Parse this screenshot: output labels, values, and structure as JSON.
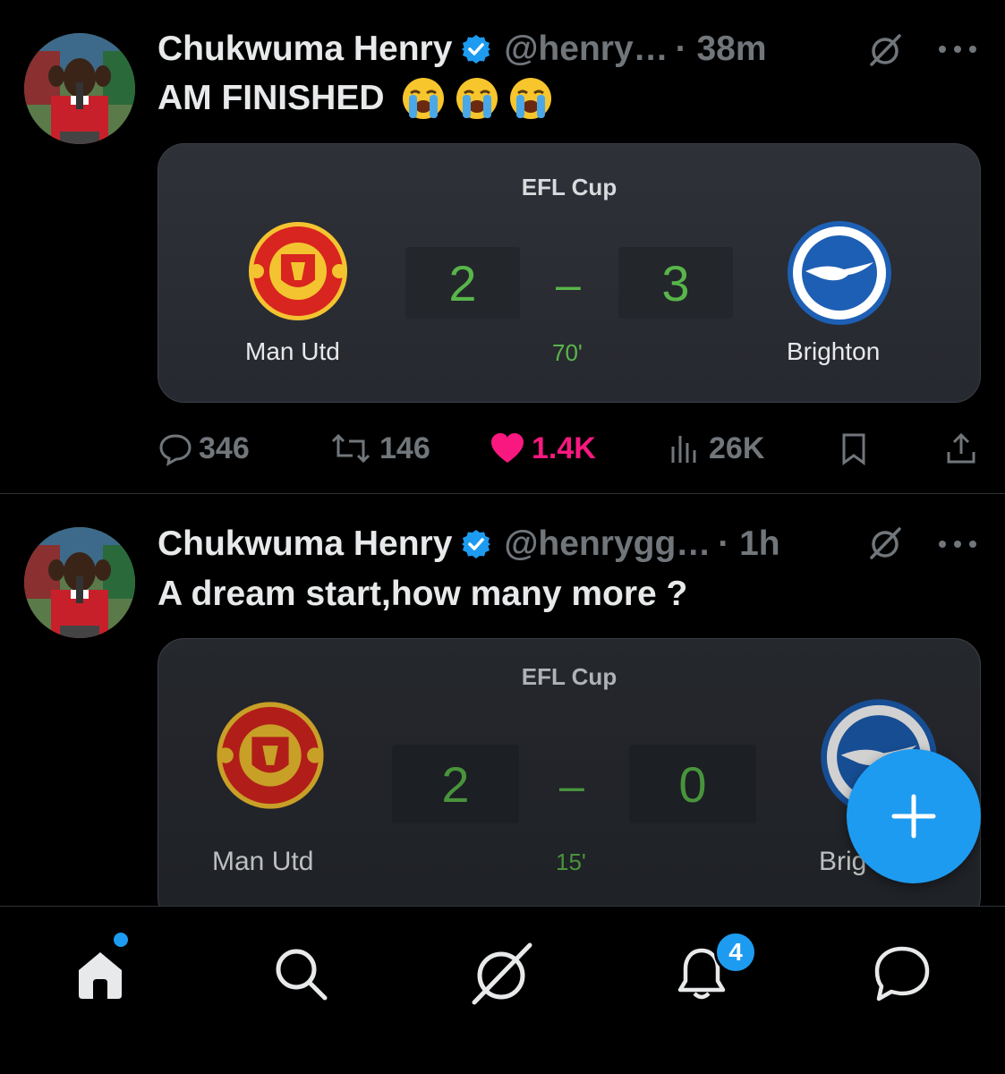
{
  "tweets": [
    {
      "author": "Chukwuma Henry",
      "handle": "@henry…",
      "time": "· 38m",
      "text": "AM FINISHED",
      "emojis": [
        "loudly-crying-face",
        "loudly-crying-face",
        "loudly-crying-face"
      ],
      "card": {
        "competition": "EFL Cup",
        "home_team": "Man Utd",
        "away_team": "Brighton",
        "home_score": "2",
        "away_score": "3",
        "separator": "–",
        "minute": "70'"
      },
      "stats": {
        "replies": "346",
        "reposts": "146",
        "likes": "1.4K",
        "views": "26K"
      }
    },
    {
      "author": "Chukwuma Henry",
      "handle": "@henrygg…",
      "time": "· 1h",
      "text": "A dream start,how many more ?",
      "card": {
        "competition": "EFL Cup",
        "home_team": "Man Utd",
        "away_team": "Brig",
        "home_score": "2",
        "away_score": "0",
        "separator": "–",
        "minute": "15'"
      }
    }
  ],
  "tabs": {
    "notifications_badge": "4"
  },
  "colors": {
    "background": "#000000",
    "accent": "#1d9bf0",
    "like": "#f91880",
    "score": "#58b54a",
    "muted": "#71767b"
  }
}
